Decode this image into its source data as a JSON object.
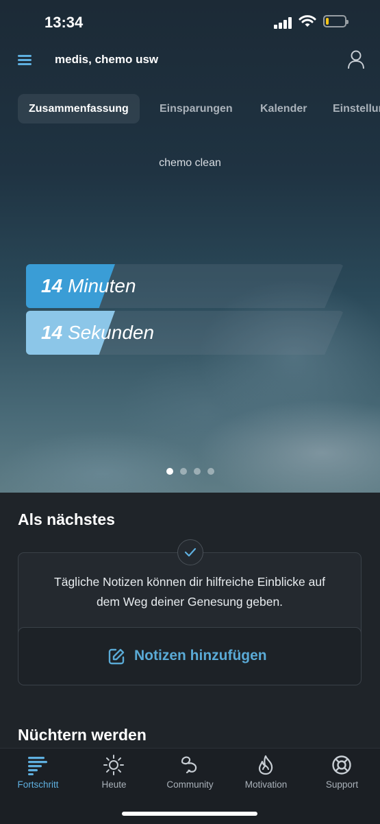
{
  "status": {
    "time": "13:34"
  },
  "header": {
    "title": "medis, chemo usw"
  },
  "tabs": [
    "Zusammenfassung",
    "Einsparungen",
    "Kalender",
    "Einstellungen"
  ],
  "hero": {
    "subtitle": "chemo clean",
    "counters": [
      {
        "value": "14",
        "unit": "Minuten",
        "accent": "#3a9dd6"
      },
      {
        "value": "14",
        "unit": "Sekunden",
        "accent": "#8cc6e8"
      }
    ],
    "page_count": 4,
    "active_page": 1
  },
  "next": {
    "title": "Als nächstes",
    "card_text": "Tägliche Notizen können dir hilfreiche Einblicke auf dem Weg deiner Genesung geben.",
    "button_label": "Notizen hinzufügen"
  },
  "sober": {
    "title": "Nüchtern werden"
  },
  "tabbar": [
    {
      "label": "Fortschritt",
      "icon": "progress-icon",
      "active": true
    },
    {
      "label": "Heute",
      "icon": "sun-icon",
      "active": false
    },
    {
      "label": "Community",
      "icon": "community-icon",
      "active": false
    },
    {
      "label": "Motivation",
      "icon": "flame-icon",
      "active": false
    },
    {
      "label": "Support",
      "icon": "lifebuoy-icon",
      "active": false
    }
  ],
  "colors": {
    "accent": "#5fb0e0",
    "background": "#1f2429"
  }
}
